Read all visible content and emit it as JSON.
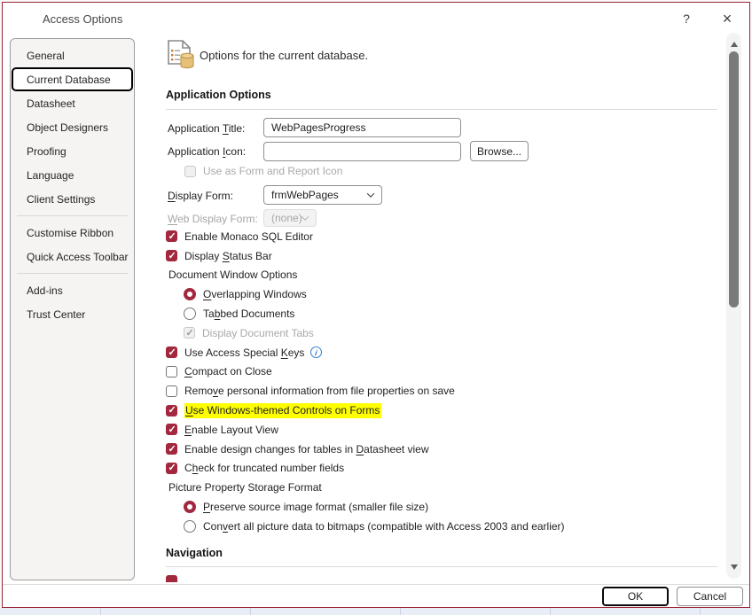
{
  "window": {
    "title": "Access Options",
    "help_glyph": "?",
    "close_glyph": "×"
  },
  "sidebar": {
    "items": [
      {
        "label": "General"
      },
      {
        "label": "Current Database",
        "selected": true
      },
      {
        "label": "Datasheet"
      },
      {
        "label": "Object Designers"
      },
      {
        "label": "Proofing"
      },
      {
        "label": "Language"
      },
      {
        "label": "Client Settings",
        "divider_after": true
      },
      {
        "label": "Customise Ribbon"
      },
      {
        "label": "Quick Access Toolbar",
        "divider_after": true
      },
      {
        "label": "Add-ins"
      },
      {
        "label": "Trust Center"
      }
    ]
  },
  "header": {
    "icon": "database-document-icon",
    "text": "Options for the current database."
  },
  "sections": {
    "application_options": "Application Options",
    "navigation": "Navigation"
  },
  "form": {
    "application_title": {
      "label": {
        "text": "Application Title:",
        "u": 12
      },
      "value": "WebPagesProgress"
    },
    "application_icon": {
      "label": {
        "text": "Application Icon:",
        "u": 12
      },
      "value": "",
      "browse_label": "Browse..."
    },
    "use_as_form_icon": {
      "label": {
        "text": "Use as Form and Report Icon"
      },
      "checked": false,
      "disabled": true
    },
    "display_form": {
      "label": {
        "text": "Display Form:",
        "u": 0
      },
      "value": "frmWebPages"
    },
    "web_display_form": {
      "label": {
        "text": "Web Display Form:",
        "u": 0
      },
      "value": "(none)",
      "disabled": true
    }
  },
  "options": [
    {
      "type": "checkbox",
      "checked": true,
      "label": {
        "text": "Enable Monaco SQL Editor"
      }
    },
    {
      "type": "checkbox",
      "checked": true,
      "label": {
        "text": "Display Status Bar",
        "u": 8
      }
    },
    {
      "type": "group",
      "label": {
        "text": "Document Window Options"
      }
    },
    {
      "type": "radio",
      "checked": true,
      "indent": true,
      "label": {
        "text": "Overlapping Windows",
        "u": 0
      }
    },
    {
      "type": "radio",
      "checked": false,
      "indent": true,
      "label": {
        "text": "Tabbed Documents",
        "u": 2
      }
    },
    {
      "type": "checkbox",
      "checked": true,
      "disabled": true,
      "indent": true,
      "label": {
        "text": "Display Document Tabs"
      }
    },
    {
      "type": "checkbox",
      "checked": true,
      "label": {
        "text": "Use Access Special Keys",
        "u": 19
      },
      "info": true
    },
    {
      "type": "checkbox",
      "checked": false,
      "label": {
        "text": "Compact on Close",
        "u": 0
      }
    },
    {
      "type": "checkbox",
      "checked": false,
      "label": {
        "text": "Remove personal information from file properties on save",
        "u": 4
      }
    },
    {
      "type": "checkbox",
      "checked": true,
      "highlight": true,
      "label": {
        "text": "Use Windows-themed Controls on Forms",
        "u": 0
      }
    },
    {
      "type": "checkbox",
      "checked": true,
      "label": {
        "text": "Enable Layout View",
        "u": 0
      }
    },
    {
      "type": "checkbox",
      "checked": true,
      "label": {
        "text": "Enable design changes for tables in Datasheet view",
        "u": 36
      }
    },
    {
      "type": "checkbox",
      "checked": true,
      "label": {
        "text": "Check for truncated number fields",
        "u": 1
      }
    },
    {
      "type": "group",
      "label": {
        "text": "Picture Property Storage Format"
      }
    },
    {
      "type": "radio",
      "checked": true,
      "indent": true,
      "label": {
        "text": "Preserve source image format (smaller file size)",
        "u": 0
      }
    },
    {
      "type": "radio",
      "checked": false,
      "indent": true,
      "label": {
        "text": "Convert all picture data to bitmaps (compatible with Access 2003 and earlier)",
        "u": 3
      }
    }
  ],
  "info_badge_glyph": "i",
  "footer": {
    "ok_label": "OK",
    "cancel_label": "Cancel"
  },
  "colors": {
    "accent": "#a2283e",
    "dialog_border": "#9a2333",
    "highlight": "#ffff00",
    "info_blue": "#2f7fd0"
  }
}
